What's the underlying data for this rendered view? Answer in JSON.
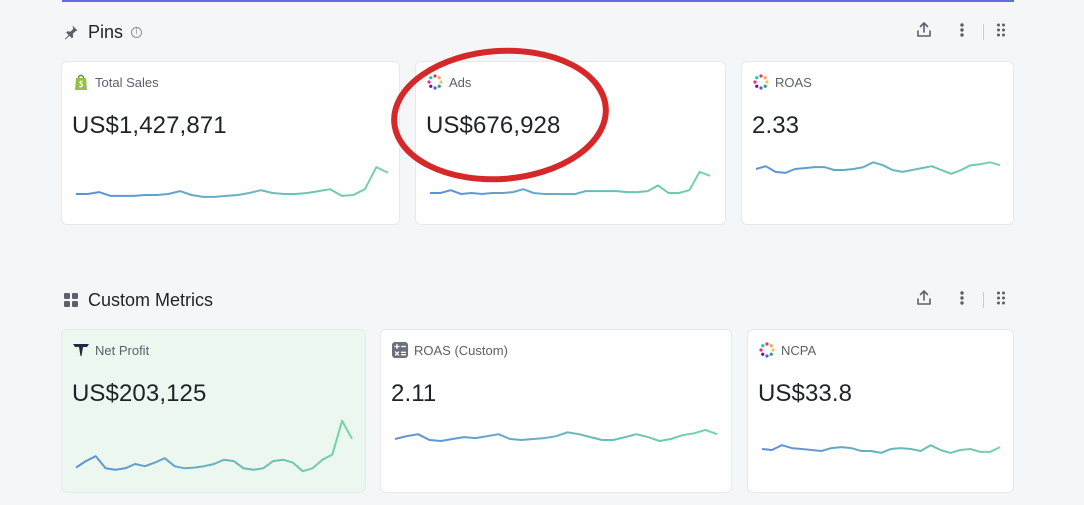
{
  "pins": {
    "title": "Pins",
    "cards": [
      {
        "label": "Total Sales",
        "value": "US$1,427,871",
        "icon": "shopify-icon",
        "spark": [
          0.5,
          0.5,
          0.42,
          0.58,
          0.58,
          0.58,
          0.54,
          0.54,
          0.5,
          0.38,
          0.54,
          0.62,
          0.62,
          0.58,
          0.54,
          0.46,
          0.34,
          0.46,
          0.5,
          0.5,
          0.46,
          0.38,
          0.3,
          0.58,
          0.54,
          0.3,
          -0.62,
          -0.38
        ]
      },
      {
        "label": "Ads",
        "value": "US$676,928",
        "icon": "colorful-dots-icon",
        "spark": [
          0.46,
          0.46,
          0.34,
          0.5,
          0.46,
          0.5,
          0.46,
          0.46,
          0.42,
          0.3,
          0.46,
          0.5,
          0.5,
          0.5,
          0.5,
          0.38,
          0.38,
          0.38,
          0.38,
          0.42,
          0.42,
          0.38,
          0.14,
          0.46,
          0.46,
          0.34,
          -0.42,
          -0.26
        ]
      },
      {
        "label": "ROAS",
        "value": "2.33",
        "icon": "colorful-dots-icon",
        "spark": [
          0.46,
          0.34,
          0.58,
          0.62,
          0.46,
          0.42,
          0.38,
          0.38,
          0.5,
          0.5,
          0.46,
          0.38,
          0.18,
          0.3,
          0.5,
          0.58,
          0.5,
          0.42,
          0.34,
          0.5,
          0.66,
          0.5,
          0.3,
          0.26,
          0.18,
          0.3
        ]
      }
    ]
  },
  "custom": {
    "title": "Custom Metrics",
    "cards": [
      {
        "label": "Net Profit",
        "value": "US$203,125",
        "icon": "triple-whale-icon",
        "spark": [
          0.6,
          0.42,
          0.28,
          0.62,
          0.66,
          0.62,
          0.5,
          0.56,
          0.46,
          0.34,
          0.56,
          0.62,
          0.6,
          0.56,
          0.5,
          0.38,
          0.42,
          0.62,
          0.66,
          0.62,
          0.42,
          0.38,
          0.46,
          0.7,
          0.62,
          0.38,
          0.24,
          -0.7,
          -0.2
        ]
      },
      {
        "label": "ROAS (Custom)",
        "value": "2.11",
        "icon": "calculator-icon",
        "spark": [
          0.46,
          0.34,
          0.26,
          0.5,
          0.54,
          0.46,
          0.38,
          0.42,
          0.34,
          0.26,
          0.46,
          0.5,
          0.46,
          0.42,
          0.34,
          0.18,
          0.26,
          0.38,
          0.5,
          0.5,
          0.38,
          0.26,
          0.38,
          0.54,
          0.46,
          0.3,
          0.22,
          0.08,
          0.26
        ]
      },
      {
        "label": "NCPA",
        "value": "US$33.8",
        "icon": "colorful-dots-icon",
        "spark": [
          0.46,
          0.5,
          0.3,
          0.42,
          0.46,
          0.5,
          0.54,
          0.42,
          0.38,
          0.42,
          0.54,
          0.54,
          0.62,
          0.46,
          0.42,
          0.46,
          0.54,
          0.3,
          0.5,
          0.62,
          0.5,
          0.46,
          0.58,
          0.58,
          0.38
        ]
      }
    ]
  },
  "colors": {
    "accent": "#5b6ee1",
    "highlight": "#d62828",
    "spark_blue": "#5b8fdc",
    "spark_green": "#74d6a4"
  },
  "actions": [
    "upload-icon",
    "more-vertical-icon",
    "drag-handle-icon"
  ]
}
